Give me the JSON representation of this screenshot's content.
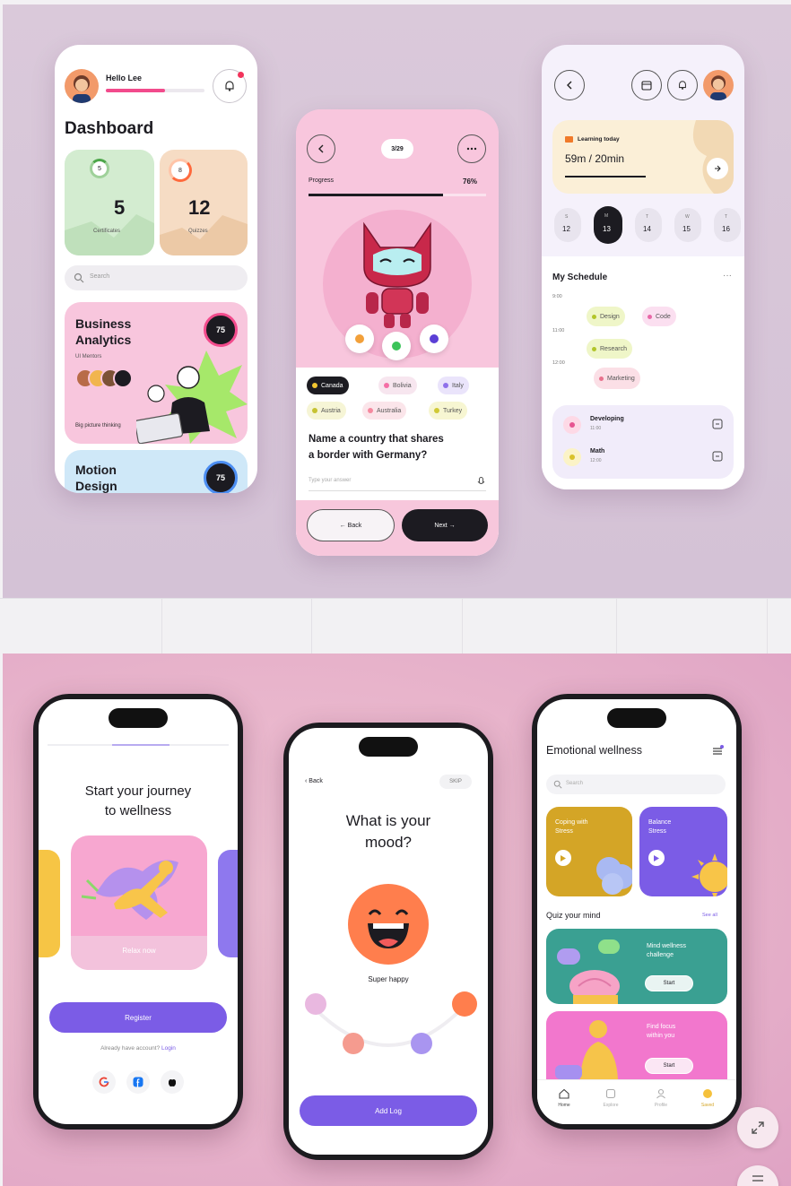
{
  "dashboard": {
    "greeting": "Hello Lee",
    "title": "Dashboard",
    "stat1": {
      "ring_value": "5",
      "value": "5",
      "label": "Certificates"
    },
    "stat2": {
      "ring_value": "8",
      "value": "12",
      "label": "Quizzes"
    },
    "search_placeholder": "Search",
    "course1": {
      "title_line1": "Business",
      "title_line2": "Analytics",
      "subtitle": "UI Mentors",
      "badge": "75",
      "footer": "Big picture thinking"
    },
    "course2": {
      "title_line1": "Motion",
      "title_line2": "Design",
      "badge": "75"
    }
  },
  "quiz": {
    "counter": "3/29",
    "progress_label": "Progress",
    "progress_value": "76%",
    "progress": 0.76,
    "answers_row1": [
      "Canada",
      "Bolivia",
      "Italy"
    ],
    "answers_row2": [
      "Austria",
      "Australia",
      "Turkey"
    ],
    "question_line1": "Name a country that shares",
    "question_line2": "a border with Germany?",
    "hint": "Type your answer",
    "back_label": "← Back",
    "next_label": "Next →"
  },
  "schedule": {
    "card_title": "Learning today",
    "time_value": "59m / 20min",
    "days": [
      {
        "day": "S",
        "date": "12"
      },
      {
        "day": "M",
        "date": "13"
      },
      {
        "day": "T",
        "date": "14"
      },
      {
        "day": "W",
        "date": "15"
      },
      {
        "day": "T",
        "date": "16"
      }
    ],
    "title": "My Schedule",
    "times": [
      "9:00",
      "11:00",
      "12:00"
    ],
    "events": [
      "Design",
      "Code",
      "Research",
      "Marketing"
    ],
    "lessons": [
      {
        "name": "Developing",
        "time": "11:00"
      },
      {
        "name": "Math",
        "time": "12:00"
      }
    ]
  },
  "onboarding": {
    "title_line1": "Start your journey",
    "title_line2": "to wellness",
    "card_label": "Relax now",
    "register_label": "Register",
    "login_prompt": "Already have account?",
    "login_link": "Login"
  },
  "mood": {
    "back_label": "Back",
    "skip_label": "SKIP",
    "title_line1": "What is your",
    "title_line2": "mood?",
    "mood_label": "Super happy",
    "add_button": "Add Log"
  },
  "wellness": {
    "title": "Emotional wellness",
    "search_placeholder": "Search",
    "card1": {
      "title_line1": "Coping with",
      "title_line2": "Stress"
    },
    "card2": {
      "title_line1": "Balance",
      "title_line2": "Stress"
    },
    "section_title": "Quiz your mind",
    "section_link": "See all",
    "banner1": {
      "title_line1": "Mind wellness",
      "title_line2": "challenge",
      "button": "Start"
    },
    "banner2": {
      "title_line1": "Find focus",
      "title_line2": "within you",
      "button": "Start"
    },
    "nav": [
      "Home",
      "Explore",
      "Profile",
      "Saved"
    ]
  },
  "colors": {
    "accent_purple": "#7b5ce6",
    "pink": "#f8c6dd",
    "green": "#d3ecd0",
    "peach": "#f6dcc4",
    "orange": "#ff7e4d",
    "mustard": "#d4a526",
    "teal": "#3aa092"
  }
}
